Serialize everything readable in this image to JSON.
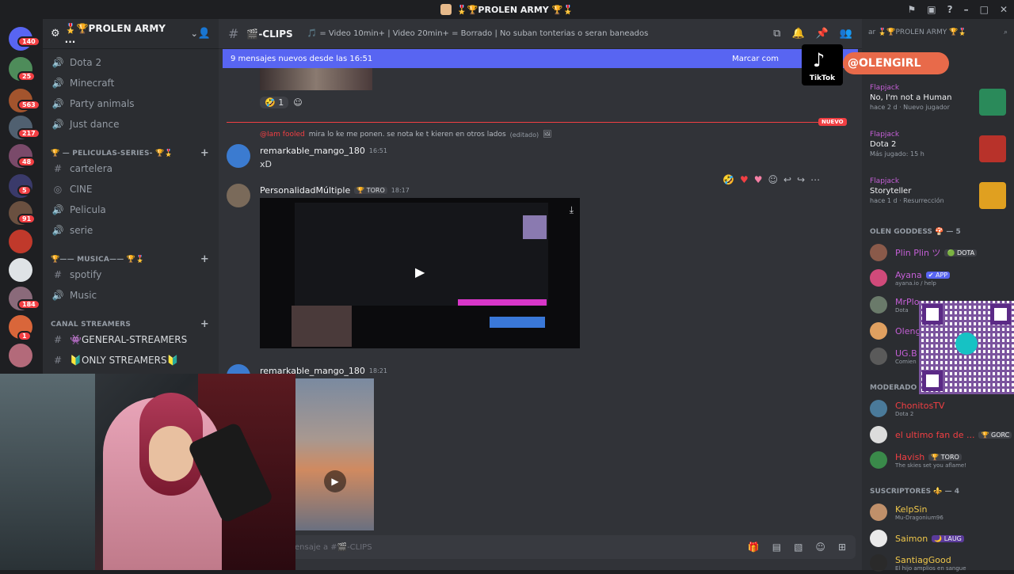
{
  "window": {
    "title": "🎖️🏆PROLEN ARMY 🏆🎖️"
  },
  "guilds": {
    "badges": [
      "140",
      "25",
      "563",
      "217",
      "48",
      "5",
      "91",
      "1",
      "184"
    ]
  },
  "server": {
    "name": "🎖️🏆PROLEN ARMY ..."
  },
  "channels": {
    "top": [
      "Dota 2",
      "Minecraft",
      "Party animals",
      "Just dance"
    ],
    "cat_movies": "🏆 — PELICULAS-SERIES- 🏆🎖️",
    "movies": [
      "cartelera",
      "CINE",
      "Pelicula",
      "serie"
    ],
    "cat_music": "🏆—— MUSICA—— 🏆🎖️",
    "music": [
      "spotify",
      "Music"
    ],
    "cat_streamers": "CANAL STREAMERS",
    "streamers": [
      "👾GENERAL-STREAMERS",
      "🔰ONLY STREAMERS🔰"
    ]
  },
  "channel": {
    "name": "🎬-CLIPS",
    "topic": "🎵 = Video 10min+ | Video 20min+ = Borrado | No suban tonterias o seran baneados"
  },
  "banner": {
    "text": "9 mensajes nuevos desde las 16:51",
    "mark": "Marcar com"
  },
  "reaction": {
    "emoji": "🤣",
    "count": "1"
  },
  "divider": {
    "label": "NUEVO"
  },
  "messages": [
    {
      "reply_mention": "@Iam fooled",
      "reply_text": "mira lo ke me ponen. se nota ke t kieren en otros lados",
      "reply_edited": "(editado)",
      "user": "remarkable_mango_180",
      "time": "16:51",
      "text": "xD"
    },
    {
      "user": "PersonalidadMúltiple",
      "tag": "🏆 TORO",
      "time": "18:17"
    },
    {
      "user": "remarkable_mango_180",
      "time": "18:21"
    }
  ],
  "composer": {
    "placeholder": "ensaje a #🎬-CLIPS"
  },
  "members": {
    "search": "ar 🎖️🏆PROLEN ARMY 🏆🎖️",
    "activities": [
      {
        "name": "Flapjack",
        "title": "No, I'm not a Human",
        "sub": "hace 2 d  ·  Nuevo jugador"
      },
      {
        "name": "Flapjack",
        "title": "Dota 2",
        "sub": "Más jugado: 15 h"
      },
      {
        "name": "Flapjack",
        "title": "Storyteller",
        "sub": "hace 1 d  ·  Resurrección"
      }
    ],
    "section_goddess": "OLEN GODDESS 🍄 — 5",
    "goddess": [
      {
        "name": "Plin Plin ツ",
        "tag": "🟢 DOTA",
        "sub": "",
        "color": "#c45fd6"
      },
      {
        "name": "Ayana",
        "tag": "✔ APP",
        "sub": "ayana.io / help",
        "color": "#c45fd6"
      },
      {
        "name": "MrPlo",
        "tag": "",
        "sub": "Dota",
        "color": "#c45fd6"
      },
      {
        "name": "Oleng",
        "tag": "",
        "sub": "",
        "color": "#c45fd6"
      },
      {
        "name": "UG.B",
        "tag": "",
        "sub": "Comien",
        "color": "#c45fd6"
      }
    ],
    "section_mods": "MODERADO",
    "mods": [
      {
        "name": "ChonitosTV",
        "tag": "",
        "sub": "Dota 2",
        "color": "#f23f43"
      },
      {
        "name": "el ultimo fan de ...",
        "tag": "🏆 GORC",
        "sub": "",
        "color": "#f23f43"
      },
      {
        "name": "Havish",
        "tag": "🏆 TORO",
        "sub": "The skies set you aflame!",
        "color": "#f23f43"
      }
    ],
    "section_subs": "SUSCRIPTORES ⚜️ — 4",
    "subs": [
      {
        "name": "KelpSin",
        "tag": "",
        "sub": "Mu-Dragonium96",
        "color": "#f0c84b"
      },
      {
        "name": "Saimon",
        "tag": "🌙 LAUG",
        "sub": "",
        "color": "#f0c84b"
      },
      {
        "name": "SantiagGood",
        "tag": "",
        "sub": "El hijo amplios en sangue",
        "color": "#f0c84b"
      }
    ]
  },
  "overlay": {
    "tiktok_label": "TikTok",
    "handle": "@OLENGIRL"
  },
  "colors": {
    "blurple": "#5865f2",
    "red": "#f23f43",
    "bg_main": "#313338",
    "bg_side": "#2b2d31"
  }
}
